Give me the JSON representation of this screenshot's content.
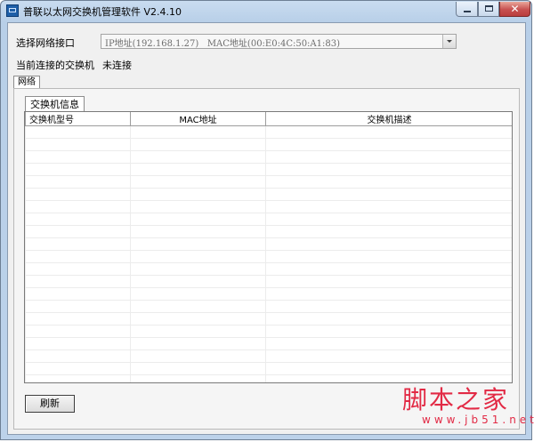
{
  "window": {
    "title": "普联以太网交换机管理软件 V2.4.10",
    "close_glyph": "✕"
  },
  "interface": {
    "label": "选择网络接口",
    "selected": "IP地址(192.168.1.27)   MAC地址(00:E0:4C:50:A1:83)"
  },
  "connection": {
    "label": "当前连接的交换机",
    "status": "未连接"
  },
  "tabs": {
    "network": "网络"
  },
  "panel": {
    "tab_label": "交换机信息",
    "columns": [
      "交换机型号",
      "MAC地址",
      "交换机描述"
    ],
    "rows": []
  },
  "buttons": {
    "refresh": "刷新"
  },
  "watermark": {
    "text": "脚本之家",
    "url": "www.jb51.net"
  },
  "colors": {
    "watermark": "#e22a45",
    "close": "#c75050"
  }
}
